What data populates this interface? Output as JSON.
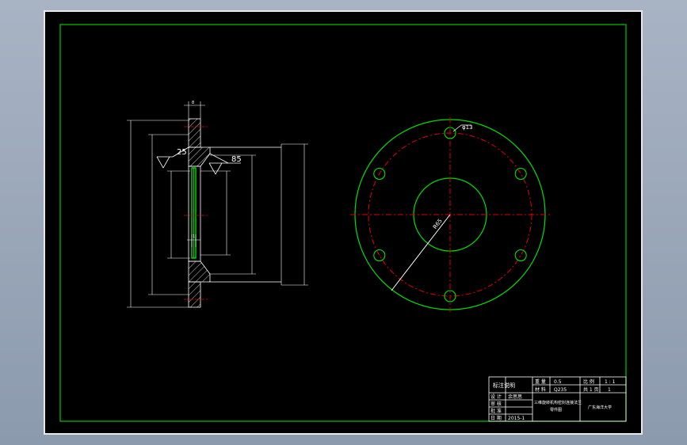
{
  "drawing": {
    "colors": {
      "background": "#000000",
      "frame": "#00c800",
      "circle_outer": "#00e000",
      "center_line": "#e00000",
      "section_outline": "#ffffff",
      "hatch": "#ffffff",
      "weld_face": "#00ff00",
      "dimension": "#ffffff",
      "title_text": "#ffffff"
    },
    "section_view": {
      "weld_symbol_1": "25",
      "weld_symbol_2": "85",
      "top_dim": "8",
      "center_dim": "1"
    },
    "plan_view": {
      "hole_callout": "φ13",
      "radius_callout": "R65",
      "bolt_hole_count": 6
    },
    "title_block": {
      "r1c1": "标注说明",
      "r2c1": "设 计",
      "r2c2": "余思思",
      "r3c1": "审 核",
      "r4c1": "批 准",
      "r5c1": "日 期",
      "r5c2": "2015-1",
      "h_weight_label": "重 量",
      "h_weight_val": "0.5",
      "h_mat_label": "材 料",
      "h_mat_val": "Q235",
      "scale_label": "比 例",
      "scale_val": "1 : 1",
      "sheet_label": "共 1 页",
      "sheet_val": "1",
      "part_name": "三维旋转机构密封连接法兰",
      "part_name_2": "零件图",
      "school": "广东海洋大学"
    }
  }
}
